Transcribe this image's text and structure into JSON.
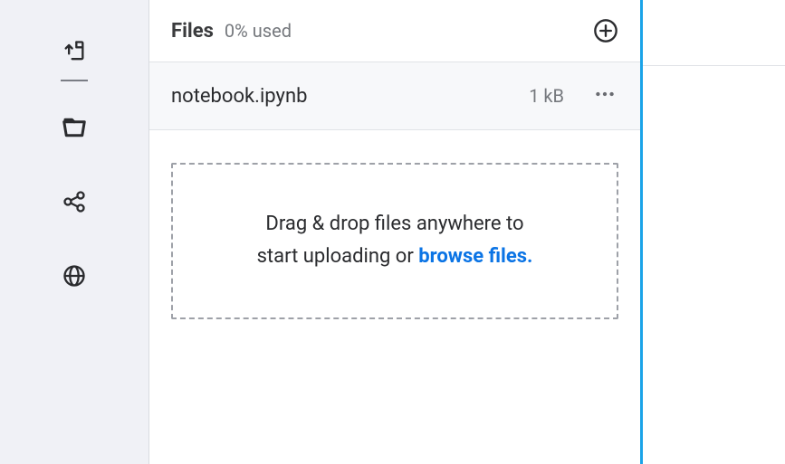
{
  "sidebar": {
    "items": [
      {
        "name": "upload-file-icon"
      },
      {
        "name": "folder-icon"
      },
      {
        "name": "share-icon"
      },
      {
        "name": "globe-icon"
      }
    ]
  },
  "files": {
    "title": "Files",
    "usage": "0% used",
    "add_label": "Add",
    "list": [
      {
        "name": "notebook.ipynb",
        "size": "1 kB"
      }
    ],
    "dropzone": {
      "line1": "Drag & drop files anywhere to",
      "line2_prefix": "start uploading or ",
      "browse_label": "browse files.",
      "line2_suffix": ""
    }
  }
}
